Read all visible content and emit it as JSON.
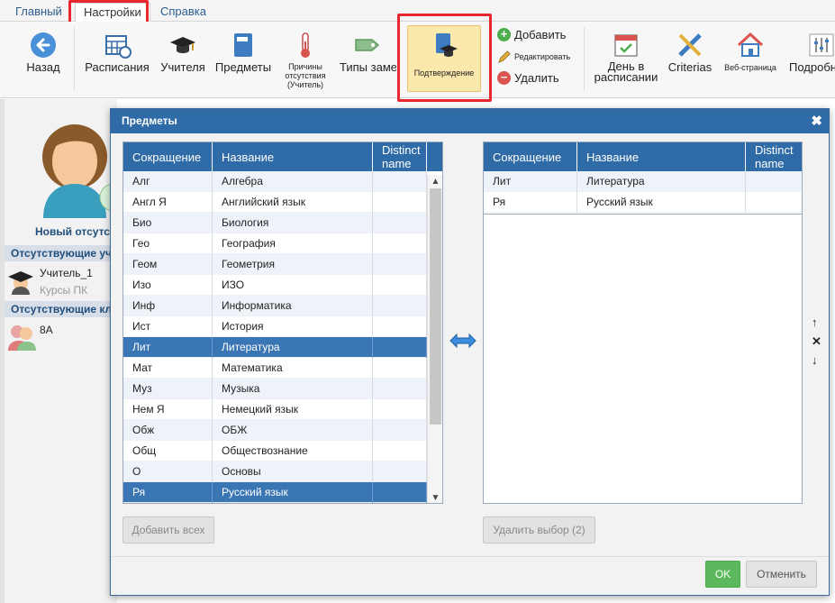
{
  "tabs": [
    "Главный",
    "Настройки",
    "Справка"
  ],
  "ribbon": {
    "back": "Назад",
    "schedules": "Расписания",
    "teachers": "Учителя",
    "subjects": "Предметы",
    "reasons": "Причины отсутствия (Учитель)",
    "sub_types": "Типы замен",
    "confirmation": "Подтверждение",
    "add": "Добавить",
    "edit": "Редактировать",
    "delete": "Удалить",
    "day_in_schedule": "День в расписании",
    "criterias": "Criterias",
    "web_page": "Веб-страница",
    "details": "Подробно"
  },
  "background": {
    "new_absent": "Новый отсутст",
    "absent_teachers": "Отсутствующие учи",
    "teacher_name": "Учитель_1",
    "teacher_course": "Курсы ПК",
    "absent_classes": "Отсутствующие кла",
    "class_name": "8А"
  },
  "modal": {
    "title": "Предметы",
    "close": "✖",
    "columns": {
      "abbr": "Сокращение",
      "name": "Название",
      "distinct": "Distinct name"
    },
    "left_rows": [
      {
        "abbr": "Алг",
        "name": "Алгебра"
      },
      {
        "abbr": "Англ Я",
        "name": "Английский язык"
      },
      {
        "abbr": "Био",
        "name": "Биология"
      },
      {
        "abbr": "Гео",
        "name": "География"
      },
      {
        "abbr": "Геом",
        "name": "Геометрия"
      },
      {
        "abbr": "Изо",
        "name": "ИЗО"
      },
      {
        "abbr": "Инф",
        "name": "Информатика"
      },
      {
        "abbr": "Ист",
        "name": "История"
      },
      {
        "abbr": "Лит",
        "name": "Литература",
        "selected": true
      },
      {
        "abbr": "Мат",
        "name": "Математика"
      },
      {
        "abbr": "Муз",
        "name": "Музыка"
      },
      {
        "abbr": "Нем Я",
        "name": "Немецкий язык"
      },
      {
        "abbr": "Обж",
        "name": "ОБЖ"
      },
      {
        "abbr": "Общ",
        "name": "Обществознание"
      },
      {
        "abbr": "О",
        "name": "Основы"
      },
      {
        "abbr": "Ря",
        "name": "Русский язык",
        "selected": true
      }
    ],
    "right_rows": [
      {
        "abbr": "Лит",
        "name": "Литература"
      },
      {
        "abbr": "Ря",
        "name": "Русский язык"
      }
    ],
    "add_all": "Добавить всех",
    "remove_selected": "Удалить выбор (2)",
    "ok": "OK",
    "cancel": "Отменить",
    "side_up": "↑",
    "side_remove": "✕",
    "side_down": "↓"
  },
  "colors": {
    "header": "#2f6ba7",
    "selected_row": "#3a76b3",
    "highlight": "#e8272f",
    "ok": "#5cb85c"
  }
}
